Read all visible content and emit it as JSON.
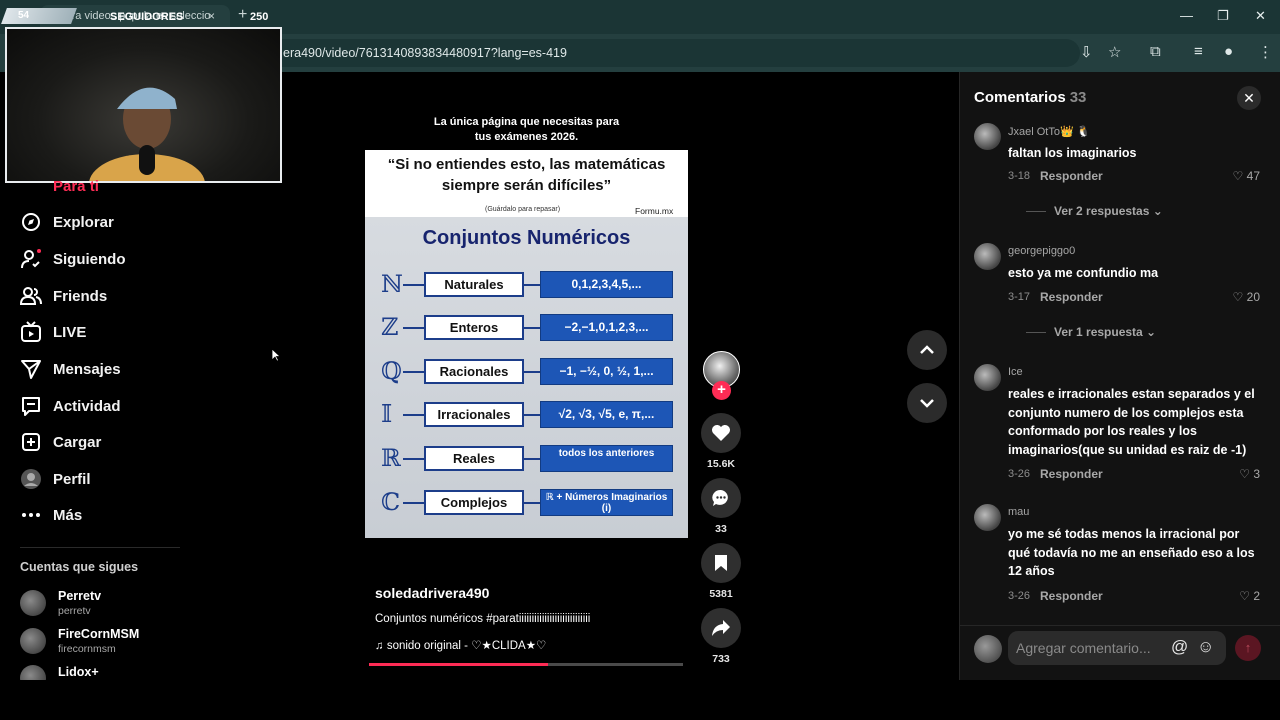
{
  "browser": {
    "tab_title": "Mira videos populares seleccio",
    "url": "era490/video/7613140893834480917?lang=es-419",
    "new_tab": "+",
    "tab_close": "×"
  },
  "overlay": {
    "badge_number": "54",
    "label": "SEGUIDORES",
    "count": "250"
  },
  "nav": {
    "for_you": "Para ti",
    "items": [
      {
        "label": "Explorar",
        "icon": "compass-icon"
      },
      {
        "label": "Siguiendo",
        "icon": "person-follow-icon"
      },
      {
        "label": "Friends",
        "icon": "friends-icon"
      },
      {
        "label": "LIVE",
        "icon": "live-tv-icon"
      },
      {
        "label": "Mensajes",
        "icon": "send-icon"
      },
      {
        "label": "Actividad",
        "icon": "activity-icon"
      },
      {
        "label": "Cargar",
        "icon": "upload-plus-icon"
      },
      {
        "label": "Perfil",
        "icon": "avatar"
      },
      {
        "label": "Más",
        "icon": "more-dots-icon"
      }
    ],
    "following_title": "Cuentas que sigues",
    "accounts": [
      {
        "name": "Perretv",
        "handle": "perretv"
      },
      {
        "name": "FireCornMSM",
        "handle": "firecornmsm"
      },
      {
        "name": "Lidox+",
        "handle": ""
      }
    ]
  },
  "video": {
    "top_text_1": "La única página que necesitas para",
    "top_text_2": "tus exámenes 2026.",
    "quote_1": "“Si no entiendes esto, las matemáticas",
    "quote_2": "siempre serán difíciles”",
    "save_note": "(Guárdalo para repasar)",
    "brand": "Formu.mx",
    "board_title": "Conjuntos Numéricos",
    "rows": [
      {
        "sym": "ℕ",
        "name": "Naturales",
        "value": "0,1,2,3,4,5,..."
      },
      {
        "sym": "ℤ",
        "name": "Enteros",
        "value": "−2,−1,0,1,2,3,..."
      },
      {
        "sym": "ℚ",
        "name": "Racionales",
        "value": "−1, −½, 0, ½, 1,..."
      },
      {
        "sym": "𝕀",
        "name": "Irracionales",
        "value": "√2, √3, √5, e, π,..."
      },
      {
        "sym": "ℝ",
        "name": "Reales",
        "value": "todos los anteriores"
      },
      {
        "sym": "ℂ",
        "name": "Complejos",
        "value": "ℝ + Números Imaginarios (i)"
      }
    ],
    "author": "soledadrivera490",
    "caption": "Conjuntos numéricos #paratiiiiiiiiiiiiiiiiiiiiiiiiiiii",
    "music": "♫  sonido original - ♡★CLIDA★♡",
    "progress_percent": 57
  },
  "actions": {
    "likes": "15.6K",
    "comments": "33",
    "saves": "5381",
    "shares": "733",
    "follow": "+"
  },
  "comments": {
    "title": "Comentarios",
    "count": "33",
    "close": "✕",
    "reply_label": "Responder",
    "list": [
      {
        "user": "Jxael OtTo👑 🐧",
        "text": "faltan los imaginarios",
        "date": "3-18",
        "likes": "47",
        "view_replies": "Ver 2 respuestas ⌄"
      },
      {
        "user": "georgepiggo0",
        "text": "esto ya me confundio ma",
        "date": "3-17",
        "likes": "20",
        "view_replies": "Ver 1 respuesta ⌄"
      },
      {
        "user": "Ice",
        "text": "reales e irracionales estan separados y el conjunto numero de los complejos esta conformado por los reales y los imaginarios(que su unidad es raiz de -1)",
        "date": "3-26",
        "likes": "3",
        "view_replies": ""
      },
      {
        "user": "mau",
        "text": "yo me sé todas menos la irracional por qué todavía no me an enseñado eso a los 12 años",
        "date": "3-26",
        "likes": "2",
        "view_replies": ""
      }
    ],
    "input_placeholder": "Agregar comentario...",
    "at_icon": "@",
    "emoji_icon": "☺",
    "send_icon": "↑"
  },
  "colors": {
    "accent": "#fe2c55",
    "chrome": "#1b3535",
    "board_blue": "#1d56b6"
  }
}
